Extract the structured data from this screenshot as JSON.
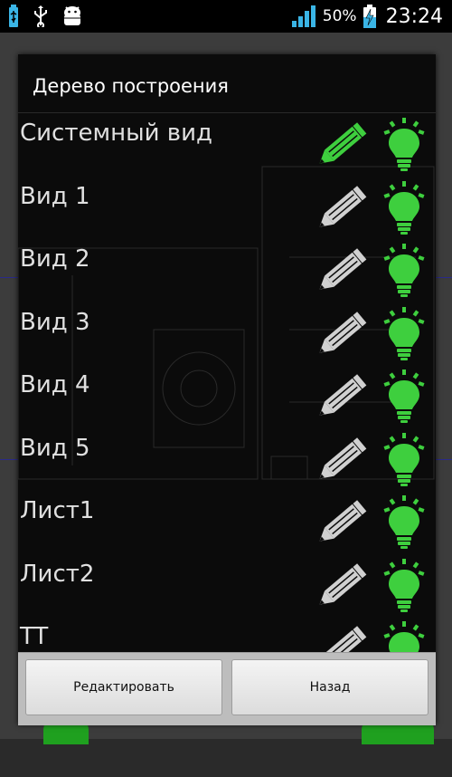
{
  "status_bar": {
    "battery_percent": "50%",
    "time": "23:24",
    "icons": [
      "usb-debug-icon",
      "usb-icon",
      "android-debug-icon",
      "signal-icon",
      "battery-charging-icon"
    ]
  },
  "dialog": {
    "title": "Дерево построения",
    "items": [
      {
        "label": "Системный вид",
        "edit_active": true
      },
      {
        "label": "Вид 1",
        "edit_active": false
      },
      {
        "label": "Вид 2",
        "edit_active": false
      },
      {
        "label": "Вид 3",
        "edit_active": false
      },
      {
        "label": "Вид 4",
        "edit_active": false
      },
      {
        "label": "Вид 5",
        "edit_active": false
      },
      {
        "label": "Лист1",
        "edit_active": false
      },
      {
        "label": "Лист2",
        "edit_active": false
      },
      {
        "label": "TT",
        "edit_active": false
      }
    ],
    "buttons": {
      "edit": "Редактировать",
      "back": "Назад"
    }
  },
  "colors": {
    "active_green": "#3ecf3e",
    "inactive_gray": "#d0d0d0",
    "dialog_bg": "#0b0b0b"
  }
}
